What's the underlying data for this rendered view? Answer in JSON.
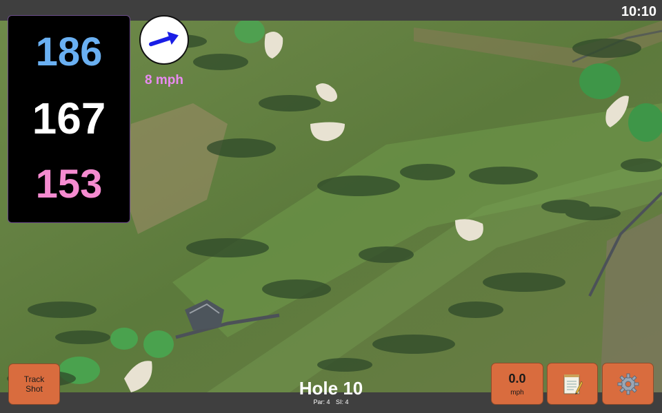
{
  "status": {
    "time": "10:10"
  },
  "distances": {
    "back": "186",
    "center": "167",
    "front": "153",
    "colors": {
      "back": "#6ab0f2",
      "center": "#ffffff",
      "front": "#f58bd0"
    }
  },
  "wind": {
    "speed_label": "8 mph",
    "icon": "arrow-right-icon",
    "arrow_color": "#1a1ee6",
    "label_color": "#e98bf2"
  },
  "track_shot": {
    "label_line1": "Track",
    "label_line2": "Shot"
  },
  "hole": {
    "title": "Hole 10",
    "par": "Par: 4",
    "si": "SI: 4"
  },
  "speed": {
    "value": "0.0",
    "unit": "mph"
  },
  "buttons": {
    "accent": "#d96c3e",
    "notes_icon": "notepad-icon",
    "settings_icon": "gear-icon"
  }
}
